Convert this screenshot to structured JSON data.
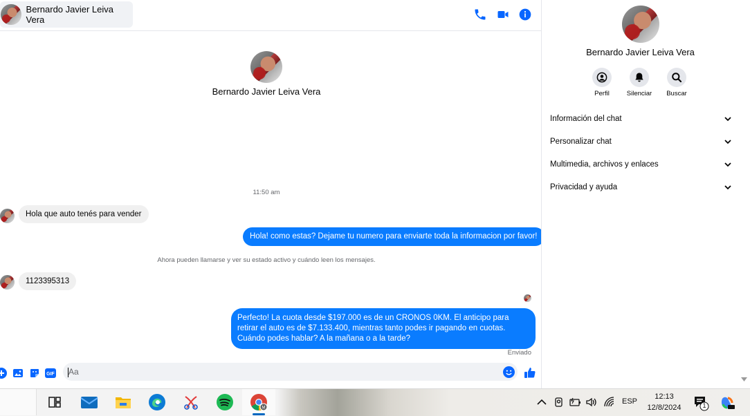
{
  "chat": {
    "header": {
      "contact_name": "Bernardo Javier Leiva Vera"
    },
    "intro": {
      "contact_name": "Bernardo Javier Leiva Vera"
    },
    "timestamp": "11:50 am",
    "notice": "Ahora pueden llamarse y ver su estado activo y cuándo leen los mensajes.",
    "messages": [
      {
        "direction": "incoming",
        "text": "Hola que auto tenés para vender"
      },
      {
        "direction": "outgoing",
        "text": "Hola! como estas? Dejame tu numero para enviarte toda la informacion por favor!"
      },
      {
        "direction": "incoming",
        "text": "1123395313"
      },
      {
        "direction": "outgoing",
        "text": "Perfecto! La cuota desde $197.000 es de un CRONOS 0KM. El anticipo para retirar el auto es de $7.133.400, mientras tanto podes ir pagando en cuotas. Cuándo podes hablar? A la mañana o a la tarde?"
      }
    ],
    "status": "Enviado",
    "composer": {
      "placeholder": "Aa",
      "gif_label": "GIF"
    }
  },
  "panel": {
    "contact_name": "Bernardo Javier Leiva Vera",
    "actions": [
      {
        "label": "Perfil",
        "icon": "user-circle-icon"
      },
      {
        "label": "Silenciar",
        "icon": "bell-icon"
      },
      {
        "label": "Buscar",
        "icon": "search-icon"
      }
    ],
    "sections": [
      {
        "label": "Información del chat"
      },
      {
        "label": "Personalizar chat"
      },
      {
        "label": "Multimedia, archivos y enlaces"
      },
      {
        "label": "Privacidad y ayuda"
      }
    ]
  },
  "taskbar": {
    "apps": [
      "task-view-icon",
      "mail-icon",
      "file-explorer-icon",
      "edge-icon",
      "snipping-tool-icon",
      "spotify-icon",
      "chrome-icon"
    ],
    "language": "ESP",
    "time": "12:13",
    "date": "12/8/2024",
    "notification_count": "1"
  },
  "colors": {
    "accent": "#0a7cff",
    "incoming_bubble": "#f0f0f0",
    "icon_blue": "#0866ff",
    "secondary_text": "#65676b"
  }
}
